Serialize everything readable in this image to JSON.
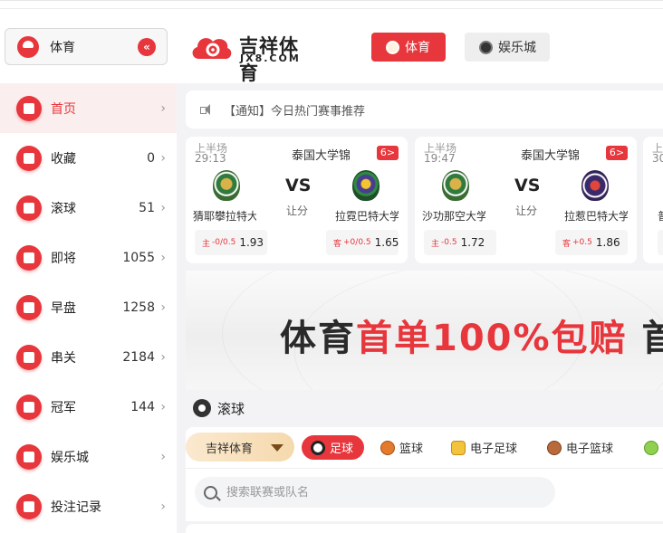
{
  "header": {
    "sport_switch": {
      "label": "体育",
      "collapse_icon": "double-chevron-left-icon"
    },
    "logo": {
      "name": "吉祥体育",
      "domain": "JX8.COM",
      "brand_color": "#e7363c"
    },
    "tabs": [
      {
        "label": "体育",
        "active": true,
        "icon": "sports-ball-icon"
      },
      {
        "label": "娱乐城",
        "active": false,
        "icon": "casino-chip-icon"
      }
    ]
  },
  "sidebar": {
    "items": [
      {
        "label": "首页",
        "count": "",
        "icon": "home-icon",
        "active": true
      },
      {
        "label": "收藏",
        "count": "0",
        "icon": "bookmark-icon",
        "active": false
      },
      {
        "label": "滚球",
        "count": "51",
        "icon": "live-ball-icon",
        "active": false
      },
      {
        "label": "即将",
        "count": "1055",
        "icon": "stopwatch-icon",
        "active": false
      },
      {
        "label": "早盘",
        "count": "1258",
        "icon": "calendar-icon",
        "active": false
      },
      {
        "label": "串关",
        "count": "2184",
        "icon": "parlay-icon",
        "active": false
      },
      {
        "label": "冠军",
        "count": "144",
        "icon": "trophy-icon",
        "active": false
      },
      {
        "label": "娱乐城",
        "count": "",
        "icon": "casino-icon",
        "active": false
      },
      {
        "label": "投注记录",
        "count": "",
        "icon": "betting-record-icon",
        "active": false
      }
    ]
  },
  "notice": {
    "text": "【通知】今日热门赛事推荐",
    "icon": "speaker-icon"
  },
  "matches": [
    {
      "period": "上半场",
      "time": "29:13",
      "league": "泰国大学锦标赛",
      "badge": "6>",
      "vs": "VS",
      "handicap_label": "让分",
      "home": {
        "name": "猜耶攀拉特大学",
        "odds_tag": "主",
        "odds_hc": "-0/0.5",
        "odds_val": "1.93"
      },
      "away": {
        "name": "拉霓巴特大学",
        "odds_tag": "客",
        "odds_hc": "+0/0.5",
        "odds_val": "1.65"
      }
    },
    {
      "period": "上半场",
      "time": "19:47",
      "league": "泰国大学锦标赛",
      "badge": "6>",
      "vs": "VS",
      "handicap_label": "让分",
      "home": {
        "name": "沙功那空大学",
        "odds_tag": "主",
        "odds_hc": "-0.5",
        "odds_val": "1.72"
      },
      "away": {
        "name": "拉惹巴特大学",
        "odds_tag": "客",
        "odds_hc": "+0.5",
        "odds_val": "1.86"
      }
    }
  ],
  "peek_card": {
    "period": "上",
    "time": "30",
    "team": "普"
  },
  "banner": {
    "slogan_dark_1": "体育",
    "slogan_red": "首单100%包赔",
    "slogan_dark_2": " 首"
  },
  "live": {
    "title": "滚球",
    "platform": "吉祥体育",
    "sport_tabs": [
      {
        "label": "足球",
        "active": true,
        "icon": "soccer-ball-icon"
      },
      {
        "label": "篮球",
        "active": false,
        "icon": "basketball-icon"
      },
      {
        "label": "电子足球",
        "active": false,
        "icon": "esoccer-icon"
      },
      {
        "label": "电子篮球",
        "active": false,
        "icon": "ebasketball-icon"
      },
      {
        "label": "",
        "active": false,
        "icon": "tennis-ball-icon"
      }
    ],
    "search_placeholder": "搜索联赛或队名"
  }
}
